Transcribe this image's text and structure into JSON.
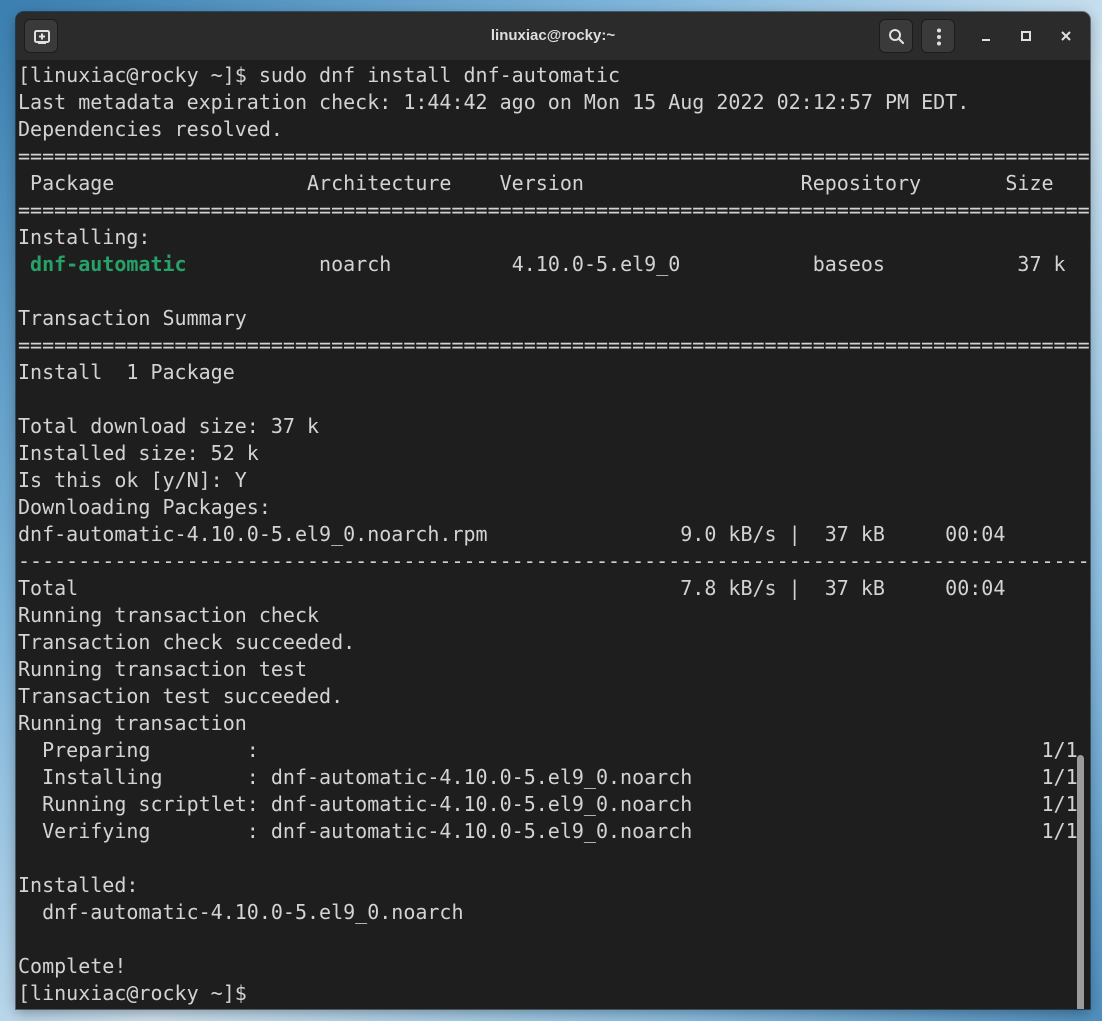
{
  "window": {
    "title": "linuxiac@rocky:~"
  },
  "colors": {
    "terminal_bg": "#1e1e1e",
    "terminal_fg": "#d3d3d3",
    "package_highlight": "#26a269",
    "titlebar_bg": "#2b2b2b"
  },
  "icons": {
    "new_tab": "new-tab-icon",
    "search": "search-icon",
    "menu": "menu-kebab-icon",
    "minimize": "minimize-icon",
    "maximize": "maximize-icon",
    "close": "close-icon"
  },
  "terminal": {
    "lines": [
      "[linuxiac@rocky ~]$ sudo dnf install dnf-automatic",
      "Last metadata expiration check: 1:44:42 ago on Mon 15 Aug 2022 02:12:57 PM EDT.",
      "Dependencies resolved.",
      "=========================================================================================",
      " Package                Architecture    Version                  Repository       Size",
      "=========================================================================================",
      "Installing:",
      "",
      "",
      "Transaction Summary",
      "=========================================================================================",
      "Install  1 Package",
      "",
      "Total download size: 37 k",
      "Installed size: 52 k",
      "Is this ok [y/N]: Y",
      "Downloading Packages:",
      "dnf-automatic-4.10.0-5.el9_0.noarch.rpm                9.0 kB/s |  37 kB     00:04",
      "-----------------------------------------------------------------------------------------",
      "Total                                                  7.8 kB/s |  37 kB     00:04",
      "Running transaction check",
      "Transaction check succeeded.",
      "Running transaction test",
      "Transaction test succeeded.",
      "Running transaction",
      "  Preparing        :                                                                 1/1",
      "  Installing       : dnf-automatic-4.10.0-5.el9_0.noarch                             1/1",
      "  Running scriptlet: dnf-automatic-4.10.0-5.el9_0.noarch                             1/1",
      "  Verifying        : dnf-automatic-4.10.0-5.el9_0.noarch                             1/1",
      "",
      "Installed:",
      "  dnf-automatic-4.10.0-5.el9_0.noarch",
      "",
      "Complete!",
      "[linuxiac@rocky ~]$"
    ],
    "package_row": {
      "indent": " ",
      "name": "dnf-automatic",
      "rest": "           noarch          4.10.0-5.el9_0           baseos           37 k"
    }
  }
}
